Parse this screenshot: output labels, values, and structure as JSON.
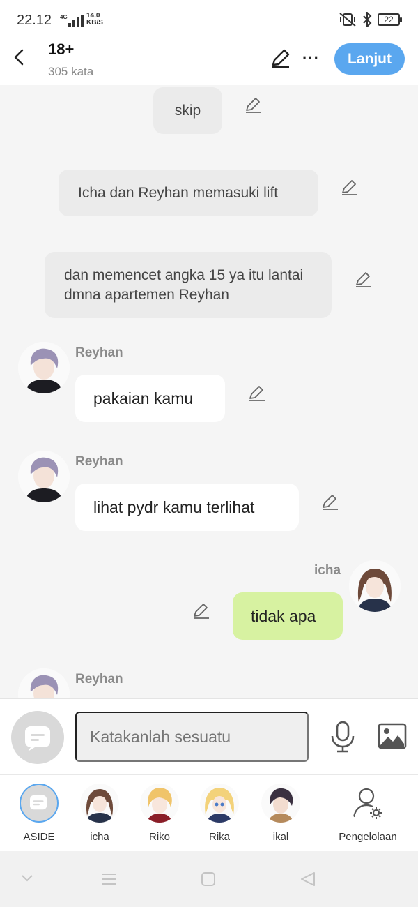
{
  "status": {
    "time": "22.12",
    "network": "4G",
    "speed_value": "14.0",
    "speed_unit": "KB/S",
    "battery": "22"
  },
  "header": {
    "title": "18+",
    "word_count": "305 kata",
    "next_label": "Lanjut"
  },
  "messages": [
    {
      "type": "narration",
      "text": "skip"
    },
    {
      "type": "narration",
      "text": "Icha dan Reyhan memasuki lift"
    },
    {
      "type": "narration",
      "text": "dan memencet angka 15 ya itu lantai dmna apartemen Reyhan"
    },
    {
      "type": "left",
      "speaker": "Reyhan",
      "text": "pakaian kamu"
    },
    {
      "type": "left",
      "speaker": "Reyhan",
      "text": "lihat pydr kamu terlihat"
    },
    {
      "type": "right",
      "speaker": "icha",
      "text": "tidak apa"
    },
    {
      "type": "left",
      "speaker": "Reyhan",
      "text": ""
    }
  ],
  "composer": {
    "placeholder": "Katakanlah sesuatu"
  },
  "characters": [
    {
      "label": "ASIDE"
    },
    {
      "label": "icha"
    },
    {
      "label": "Riko"
    },
    {
      "label": "Rika"
    },
    {
      "label": "ikal"
    },
    {
      "label": "Pengelolaan"
    }
  ],
  "colors": {
    "accent": "#5aa7ef",
    "right_bubble": "#d7f2a1",
    "narration_bubble": "#ebebeb"
  }
}
